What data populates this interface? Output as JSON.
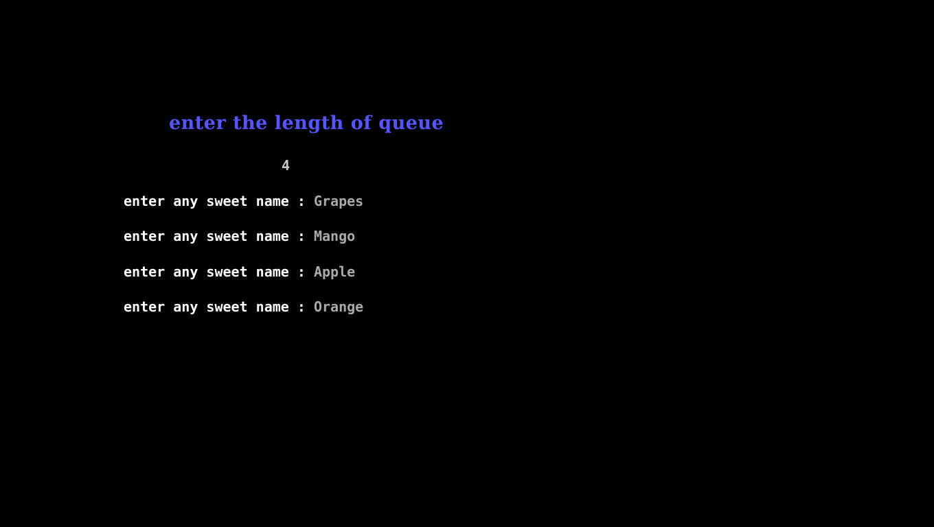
{
  "console": {
    "prompt_title": "enter the length of queue",
    "queue_length_input": "4",
    "entries": [
      {
        "label": "enter any sweet name : ",
        "value": "Grapes"
      },
      {
        "label": "enter any sweet name : ",
        "value": "Mango"
      },
      {
        "label": "enter any sweet name : ",
        "value": "Apple"
      },
      {
        "label": "enter any sweet name : ",
        "value": "Orange"
      }
    ]
  },
  "colors": {
    "background": "#000000",
    "title": "#5555ff",
    "label": "#ffffff",
    "value": "#aaaaaa"
  }
}
